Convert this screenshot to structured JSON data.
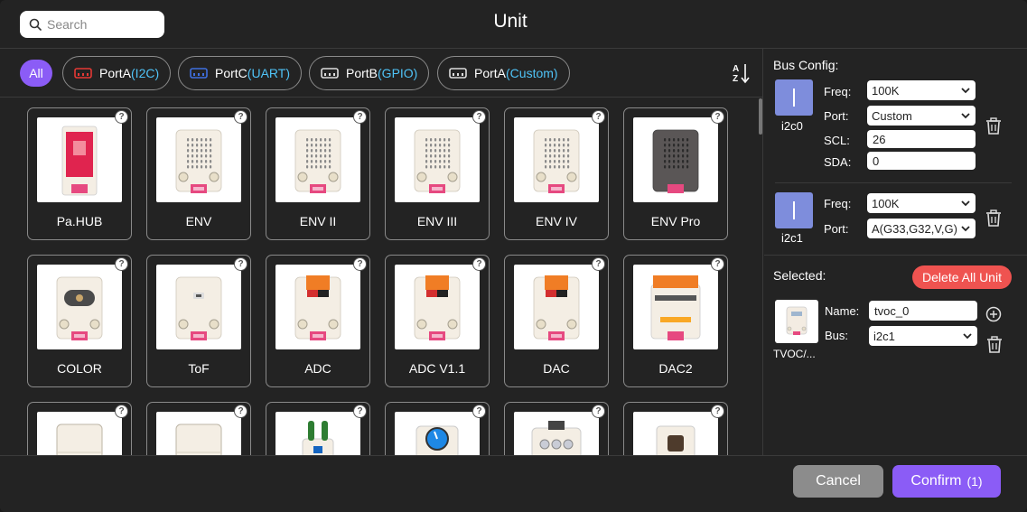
{
  "header": {
    "search_placeholder": "Search",
    "title": "Unit"
  },
  "filters": {
    "all_label": "All",
    "chips": [
      {
        "name": "PortA",
        "sub": "(I2C)",
        "plug_color": "#e53935"
      },
      {
        "name": "PortC",
        "sub": "(UART)",
        "plug_color": "#3f6fe0"
      },
      {
        "name": "PortB",
        "sub": "(GPIO)",
        "plug_color": "#dddddd"
      },
      {
        "name": "PortA",
        "sub": "(Custom)",
        "plug_color": "#dddddd"
      }
    ],
    "sort_icon": "sort-az-icon"
  },
  "units": [
    {
      "label": "Pa.HUB",
      "kind": "hub"
    },
    {
      "label": "ENV",
      "kind": "grille"
    },
    {
      "label": "ENV II",
      "kind": "grille"
    },
    {
      "label": "ENV III",
      "kind": "grille"
    },
    {
      "label": "ENV IV",
      "kind": "grille"
    },
    {
      "label": "ENV Pro",
      "kind": "dark"
    },
    {
      "label": "COLOR",
      "kind": "color"
    },
    {
      "label": "ToF",
      "kind": "tof"
    },
    {
      "label": "ADC",
      "kind": "adc"
    },
    {
      "label": "ADC V1.1",
      "kind": "adc"
    },
    {
      "label": "DAC",
      "kind": "adc"
    },
    {
      "label": "DAC2",
      "kind": "dac2"
    },
    {
      "label": "",
      "kind": "plain"
    },
    {
      "label": "",
      "kind": "plain"
    },
    {
      "label": "",
      "kind": "relay"
    },
    {
      "label": "",
      "kind": "dial"
    },
    {
      "label": "",
      "kind": "buttons"
    },
    {
      "label": "",
      "kind": "square"
    }
  ],
  "bus_config": {
    "title": "Bus Config:",
    "buses": [
      {
        "name": "i2c0",
        "freq_label": "Freq:",
        "freq": "100K",
        "port_label": "Port:",
        "port": "Custom",
        "scl_label": "SCL:",
        "scl": "26",
        "sda_label": "SDA:",
        "sda": "0"
      },
      {
        "name": "i2c1",
        "freq_label": "Freq:",
        "freq": "100K",
        "port_label": "Port:",
        "port": "A(G33,G32,V,G)"
      }
    ]
  },
  "selected": {
    "title": "Selected:",
    "delete_all": "Delete All Unit",
    "name_label": "Name:",
    "name_value": "tvoc_0",
    "bus_label": "Bus:",
    "bus_value": "i2c1",
    "caption": "TVOC/..."
  },
  "footer": {
    "cancel": "Cancel",
    "confirm": "Confirm",
    "confirm_count": "(1)"
  },
  "colors": {
    "accent": "#8b5cf6",
    "danger": "#ef5350",
    "bus_icon": "#7e8ddc",
    "port_sub": "#4fc3f7"
  }
}
